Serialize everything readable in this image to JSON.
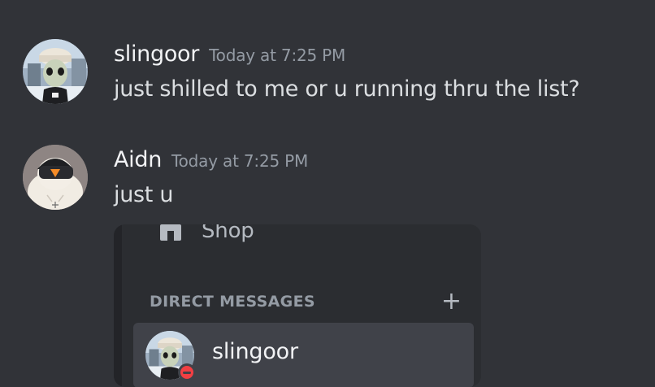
{
  "messages": [
    {
      "author": "slingoor",
      "timestamp": "Today at 7:25 PM",
      "content": "just shilled to me or u running thru the list?"
    },
    {
      "author": "Aidn",
      "timestamp": "Today at 7:25 PM",
      "content": "just u"
    }
  ],
  "embed": {
    "shop_label": "Shop",
    "dm_section_title": "DIRECT MESSAGES",
    "dm_add_icon": "plus-icon",
    "dm_items": [
      {
        "name": "slingoor",
        "status": "do-not-disturb"
      }
    ]
  },
  "colors": {
    "background": "#313338",
    "embed_background": "#2b2d31",
    "selected_item": "#404249",
    "dnd_status": "#f23f43"
  }
}
